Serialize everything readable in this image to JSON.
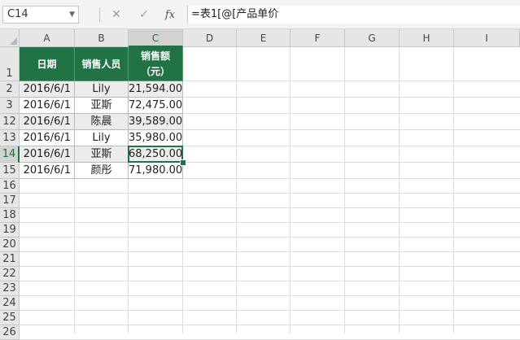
{
  "formula_bar": {
    "name_box": "C14",
    "cancel_icon": "close-icon",
    "enter_icon": "checkmark-icon",
    "fx_label": "fx",
    "formula": "=表1[@[产品单价"
  },
  "columns": [
    "A",
    "B",
    "C",
    "D",
    "E",
    "F",
    "G",
    "H",
    "I"
  ],
  "rows": [
    "1",
    "2",
    "3",
    "12",
    "13",
    "14",
    "15",
    "16",
    "17",
    "18",
    "19",
    "20",
    "21",
    "22",
    "23",
    "24",
    "25",
    "26"
  ],
  "active_cell": "C14",
  "table": {
    "headers": [
      "日期",
      "销售人员",
      "销售额\n（元）"
    ],
    "records": [
      {
        "date": "2016/6/1",
        "person": "Lily",
        "amount": "21,594.00"
      },
      {
        "date": "2016/6/1",
        "person": "亚斯",
        "amount": "72,475.00"
      },
      {
        "date": "2016/6/1",
        "person": "陈晨",
        "amount": "39,589.00"
      },
      {
        "date": "2016/6/1",
        "person": "Lily",
        "amount": "35,980.00"
      },
      {
        "date": "2016/6/1",
        "person": "亚斯",
        "amount": "68,250.00"
      },
      {
        "date": "2016/6/1",
        "person": "颜彤",
        "amount": "71,980.00"
      }
    ]
  },
  "colors": {
    "header_fill": "#217346",
    "accent": "#217346",
    "band": "#ececec"
  }
}
